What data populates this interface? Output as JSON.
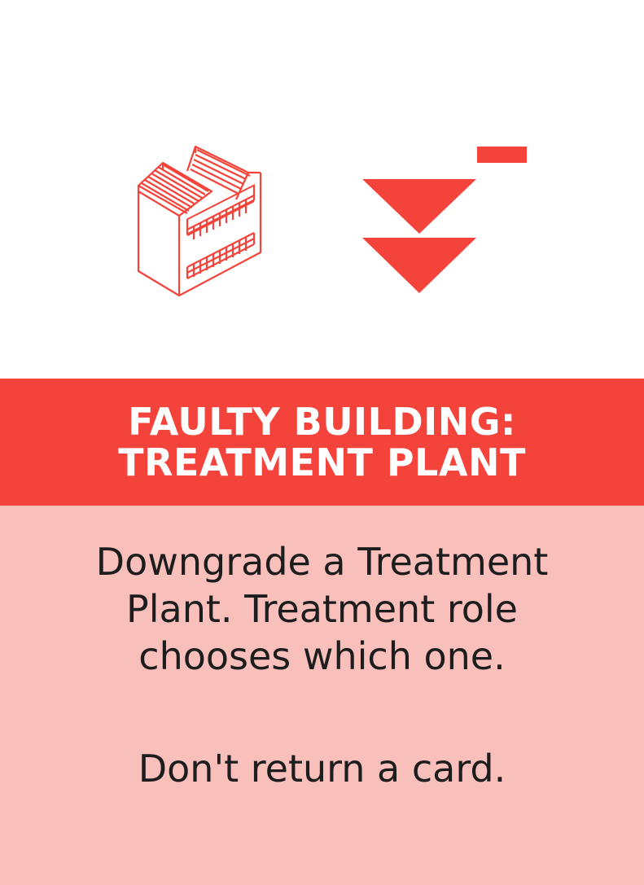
{
  "card": {
    "icons": [
      "building-icon",
      "downgrade-icon"
    ],
    "title_lines": [
      "FAULTY BUILDING:",
      "TREATMENT PLANT"
    ],
    "body_lines": [
      "Downgrade a Treatment",
      "Plant. Treatment role",
      "chooses which one."
    ],
    "footer_text": "Don't return a card.",
    "colors": {
      "accent": "#f4433a",
      "body_bg": "#f8bfbb",
      "text": "#1d1d1d",
      "top_bg": "#ffffff"
    }
  }
}
